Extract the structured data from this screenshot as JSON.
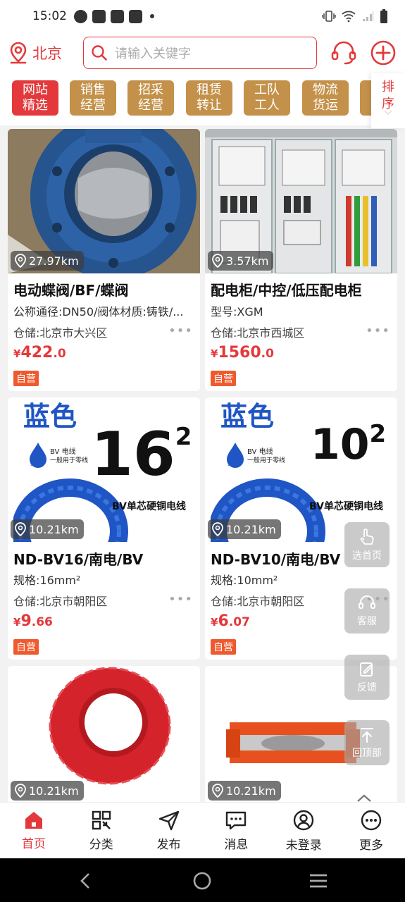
{
  "status_bar": {
    "time": "15:02"
  },
  "header": {
    "city": "北京",
    "search_placeholder": "请输入关键字"
  },
  "tabs": [
    {
      "line1": "网站",
      "line2": "精选"
    },
    {
      "line1": "销售",
      "line2": "经营"
    },
    {
      "line1": "招采",
      "line2": "经营"
    },
    {
      "line1": "租赁",
      "line2": "转让"
    },
    {
      "line1": "工队",
      "line2": "工人"
    },
    {
      "line1": "物流",
      "line2": "货运"
    }
  ],
  "sort": {
    "line1": "排",
    "line2": "序"
  },
  "products": [
    {
      "distance": "27.97km",
      "title": "电动蝶阀/BF/蝶阀",
      "spec": "公称通径:DN50/阀体材质:铸铁/...",
      "storage": "仓储:北京市大兴区",
      "price_currency": "¥",
      "price_int": "422",
      "price_dec": ".0",
      "badge": "自营"
    },
    {
      "distance": "3.57km",
      "title": "配电柜/中控/低压配电柜",
      "spec": "型号:XGM",
      "storage": "仓储:北京市西城区",
      "price_currency": "¥",
      "price_int": "1560",
      "price_dec": ".0",
      "badge": "自营"
    },
    {
      "distance": "10.21km",
      "title": "ND-BV16/南电/BV",
      "spec": "规格:16mm²",
      "storage": "仓储:北京市朝阳区",
      "price_currency": "¥",
      "price_int": "9",
      "price_dec": ".66",
      "badge": "自营",
      "img_text": {
        "top": "蓝色",
        "big": "16",
        "sup": "2",
        "drop": "BV 电线",
        "drop_sub": "一般用于零线",
        "drop_color": "蓝色",
        "product": "BV单芯硬铜电线"
      }
    },
    {
      "distance": "10.21km",
      "title": "ND-BV10/南电/BV",
      "spec": "规格:10mm²",
      "storage": "仓储:北京市朝阳区",
      "price_currency": "¥",
      "price_int": "6",
      "price_dec": ".07",
      "badge": "自营",
      "img_text": {
        "top": "蓝色",
        "big": "10",
        "sup": "2",
        "drop": "BV 电线",
        "drop_sub": "一般用于零线",
        "drop_color": "蓝色",
        "product": "BV单芯硬铜电线"
      }
    },
    {
      "distance": "10.21km"
    },
    {
      "distance": "10.21km"
    }
  ],
  "float_buttons": [
    {
      "label": "选首页",
      "icon": "hand-pointer-icon"
    },
    {
      "label": "客服",
      "icon": "headset-icon"
    },
    {
      "label": "反馈",
      "icon": "edit-icon"
    },
    {
      "label": "回顶部",
      "icon": "arrow-up-icon"
    }
  ],
  "bottom_nav": [
    {
      "label": "首页",
      "icon": "home-icon",
      "active": true
    },
    {
      "label": "分类",
      "icon": "category-icon"
    },
    {
      "label": "发布",
      "icon": "send-icon"
    },
    {
      "label": "消息",
      "icon": "message-icon"
    },
    {
      "label": "未登录",
      "icon": "user-icon"
    },
    {
      "label": "更多",
      "icon": "more-icon"
    }
  ],
  "colors": {
    "brand_red": "#e4393c",
    "tab_gold": "#c4914a",
    "badge_orange": "#ee5a2e"
  }
}
